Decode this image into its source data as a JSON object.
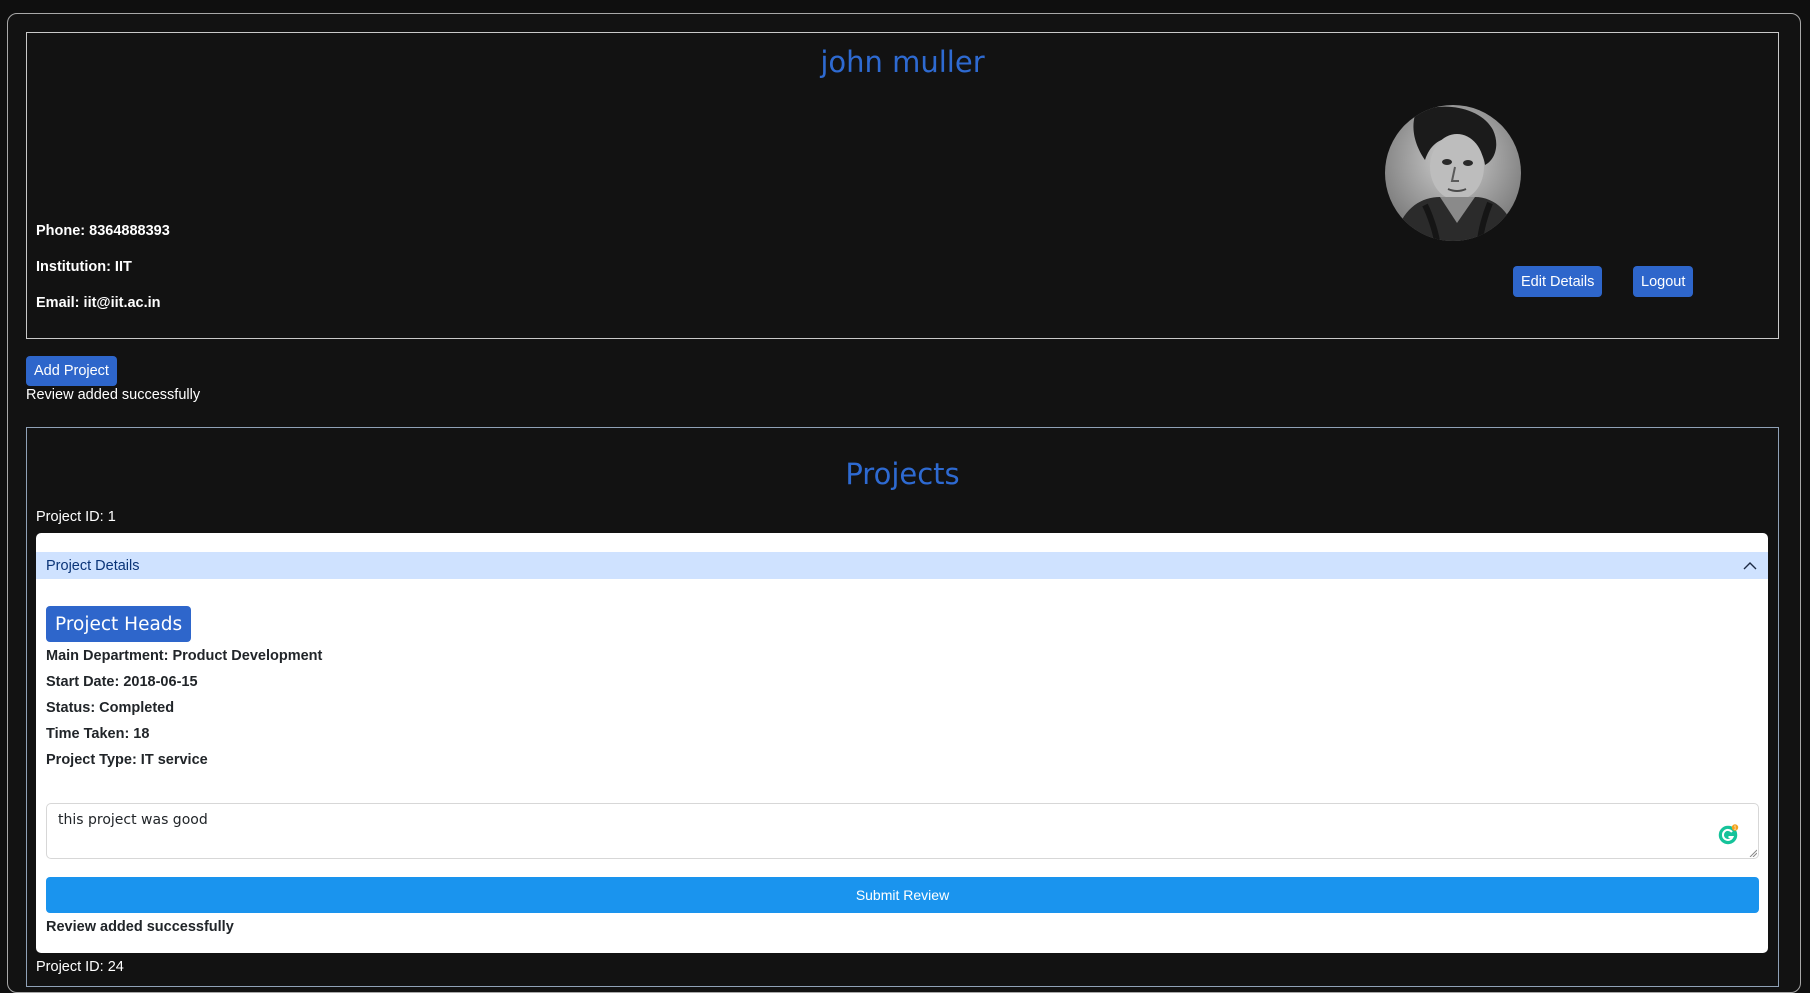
{
  "profile": {
    "name": "john muller",
    "phone_line": "Phone: 8364888393",
    "institution_line": "Institution: IIT",
    "email_line": "Email: iit@iit.ac.in",
    "edit_label": "Edit Details",
    "logout_label": "Logout"
  },
  "actions": {
    "add_project_label": "Add Project",
    "status_message": "Review added successfully"
  },
  "projects": {
    "title": "Projects",
    "items": [
      {
        "id_label": "Project ID: 1",
        "accordion_label": "Project Details",
        "heads_label": "Project Heads",
        "details": [
          "Main Department: Product Development",
          "Start Date: 2018-06-15",
          "Status: Completed",
          "Time Taken: 18",
          "Project Type: IT service"
        ],
        "review_value": "this project was good",
        "grammarly_count": "1",
        "submit_label": "Submit Review",
        "message": "Review added successfully"
      },
      {
        "id_label": "Project ID: 24"
      }
    ]
  },
  "colors": {
    "accent": "#2e66cb",
    "submit": "#1a94ee",
    "accordion_bg": "#cfe2ff"
  }
}
